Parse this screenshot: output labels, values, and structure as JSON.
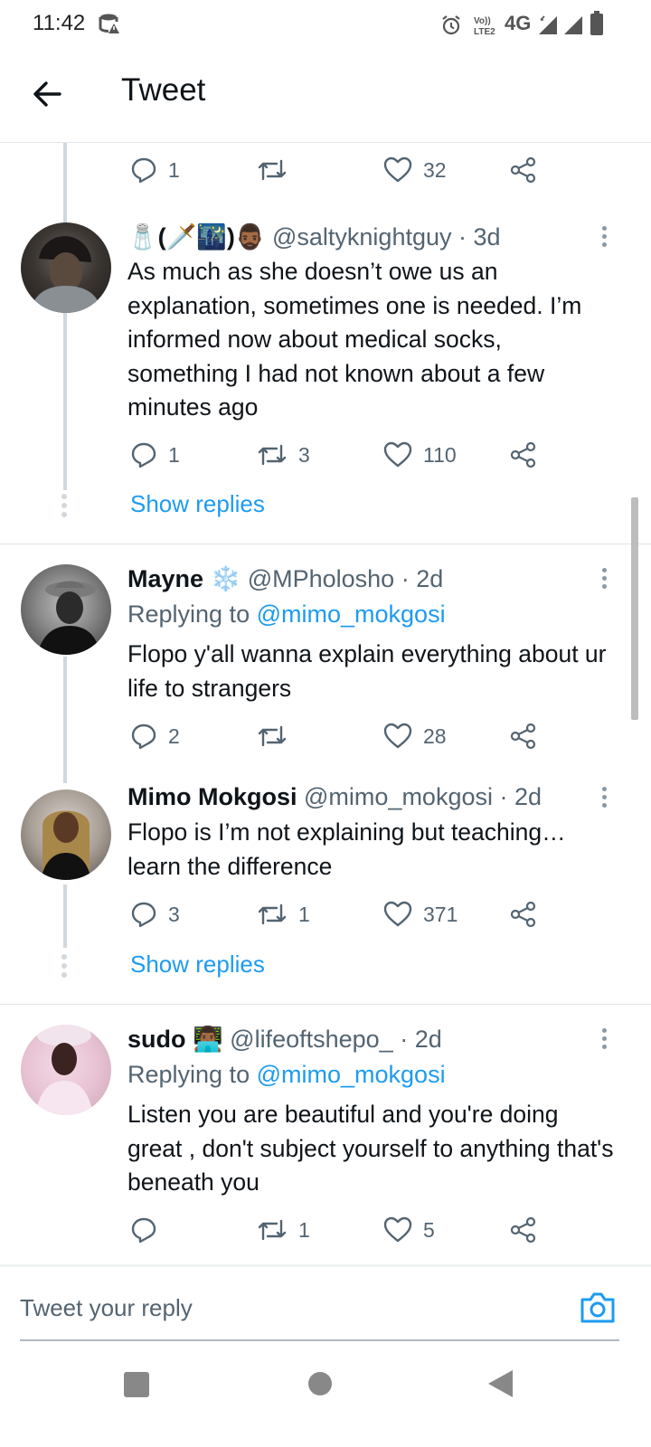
{
  "status_bar": {
    "time": "11:42",
    "network": "4G",
    "volte": "Vo)) LTE2"
  },
  "header": {
    "title": "Tweet"
  },
  "top_actions": {
    "reply_count": "1",
    "retweet_count": "",
    "like_count": "32"
  },
  "tweets": [
    {
      "display_name": "🧂(🗡️🌃)🧔🏾‍♂️",
      "handle": "@saltyknightguy",
      "time": "3d",
      "text": "As much as she doesn’t owe us an explanation, sometimes one is needed. I’m informed now about medical socks, something I had not known about a few minutes ago",
      "replies": "1",
      "retweets": "3",
      "likes": "110",
      "show_replies": "Show replies"
    },
    {
      "display_name": "Mayne",
      "name_emoji": "❄️",
      "handle": "@MPholosho",
      "time": "2d",
      "replying_prefix": "Replying to",
      "replying_to": "@mimo_mokgosi",
      "text": "Flopo y'all wanna explain everything about ur life to strangers",
      "replies": "2",
      "retweets": "",
      "likes": "28"
    },
    {
      "display_name": "Mimo Mokgosi",
      "handle": "@mimo_mokgosi",
      "time": "2d",
      "text": "Flopo is I’m not explaining but teaching… learn the difference",
      "replies": "3",
      "retweets": "1",
      "likes": "371",
      "show_replies": "Show replies"
    },
    {
      "display_name": "sudo",
      "name_emoji": "👨🏾‍💻",
      "handle": "@lifeoftshepo_",
      "time": "2d",
      "replying_prefix": "Replying to",
      "replying_to": "@mimo_mokgosi",
      "text": "Listen you are beautiful and you're doing great , don't subject yourself to anything that's beneath you",
      "replies": "",
      "retweets": "1",
      "likes": "5"
    }
  ],
  "reply_box": {
    "placeholder": "Tweet your reply"
  },
  "colors": {
    "accent": "#1d9bf0",
    "text": "#0f1419",
    "muted": "#536471",
    "thread_line": "#cfd9de"
  }
}
